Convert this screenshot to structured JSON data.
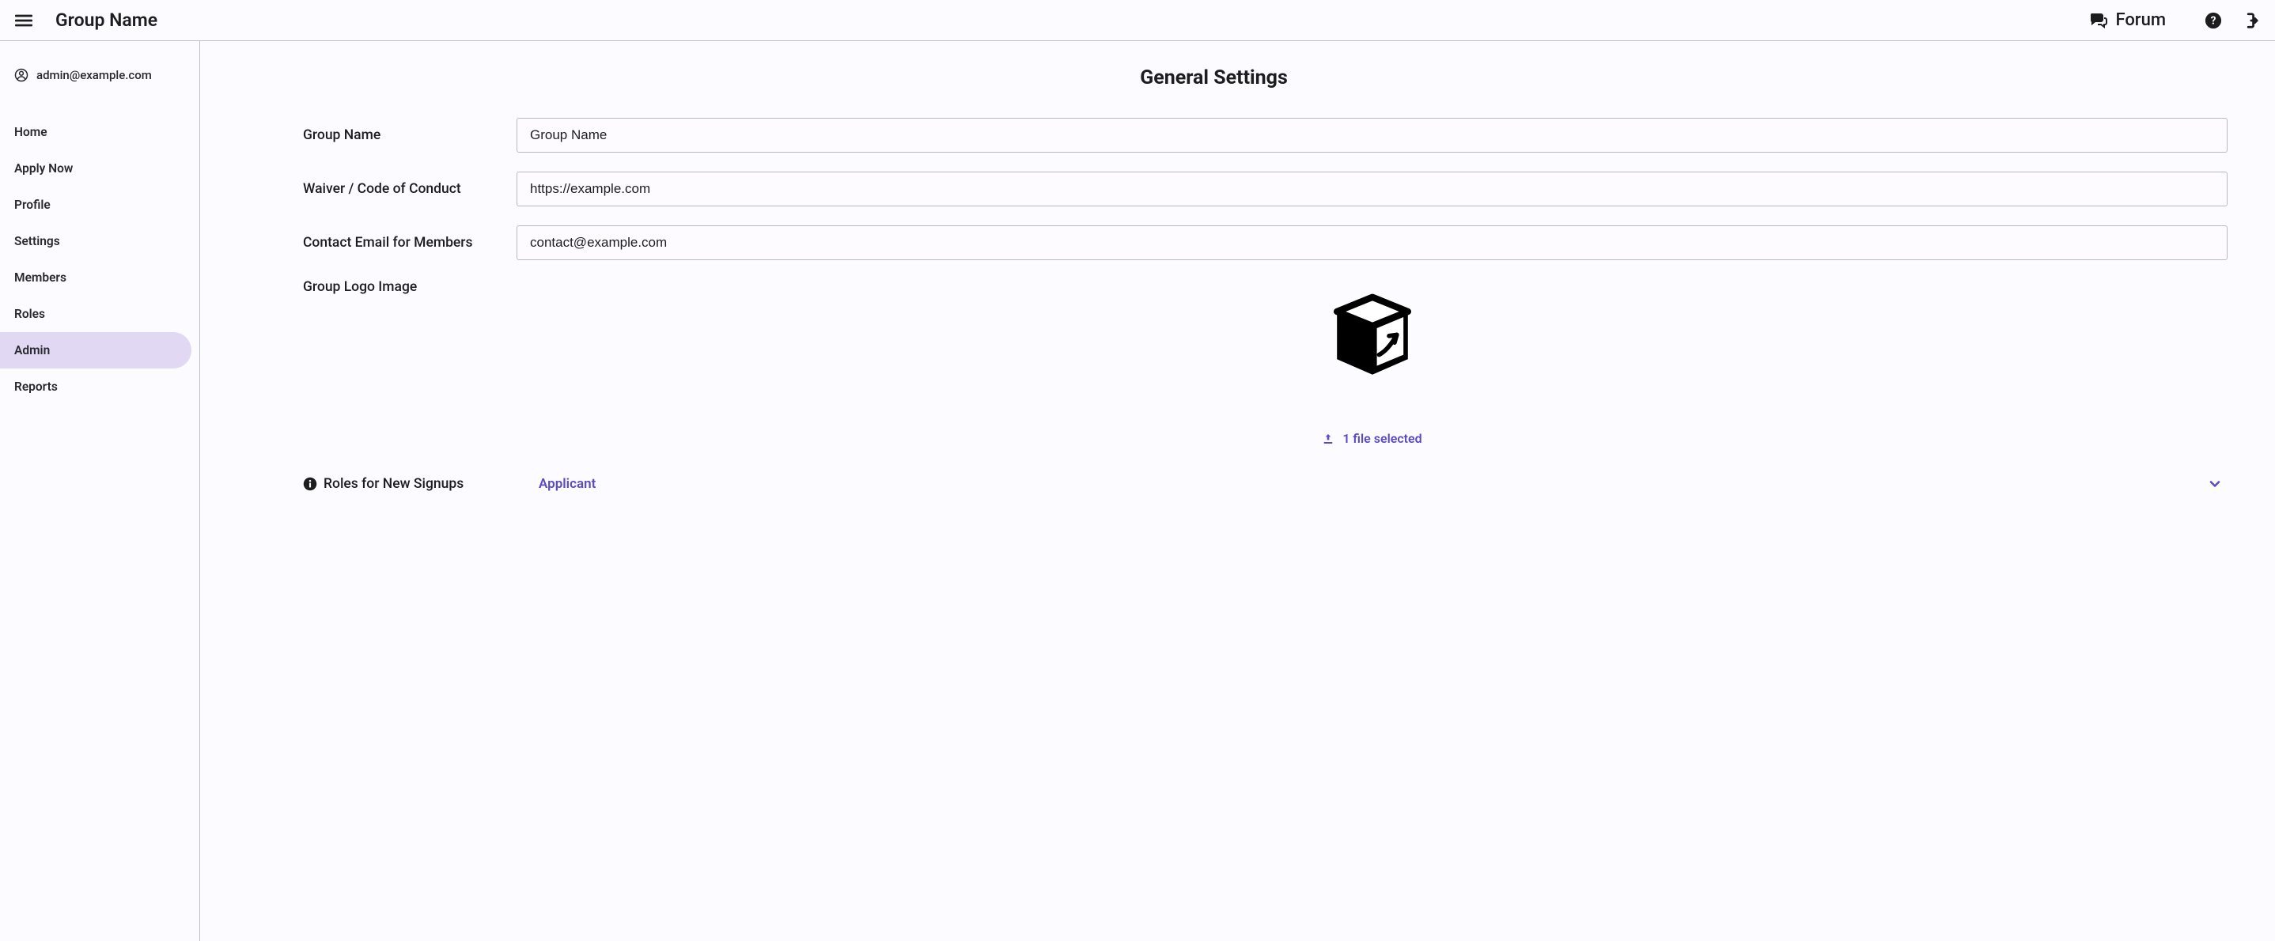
{
  "header": {
    "title": "Group Name",
    "forum_label": "Forum"
  },
  "sidebar": {
    "user_email": "admin@example.com",
    "items": [
      {
        "label": "Home"
      },
      {
        "label": "Apply Now"
      },
      {
        "label": "Profile"
      },
      {
        "label": "Settings"
      },
      {
        "label": "Members"
      },
      {
        "label": "Roles"
      },
      {
        "label": "Admin"
      },
      {
        "label": "Reports"
      }
    ],
    "active_index": 6
  },
  "main": {
    "heading": "General Settings",
    "fields": {
      "group_name": {
        "label": "Group Name",
        "value": "Group Name"
      },
      "waiver": {
        "label": "Waiver / Code of Conduct",
        "value": "https://example.com"
      },
      "contact": {
        "label": "Contact Email for Members",
        "value": "contact@example.com"
      },
      "logo": {
        "label": "Group Logo Image",
        "file_status": "1 file selected"
      },
      "roles_signup": {
        "label": "Roles for New Signups",
        "value": "Applicant"
      }
    }
  },
  "colors": {
    "accent": "#5a4bc4",
    "sidebar_active_bg": "#e1d9f4",
    "border": "#bfbfc7"
  }
}
